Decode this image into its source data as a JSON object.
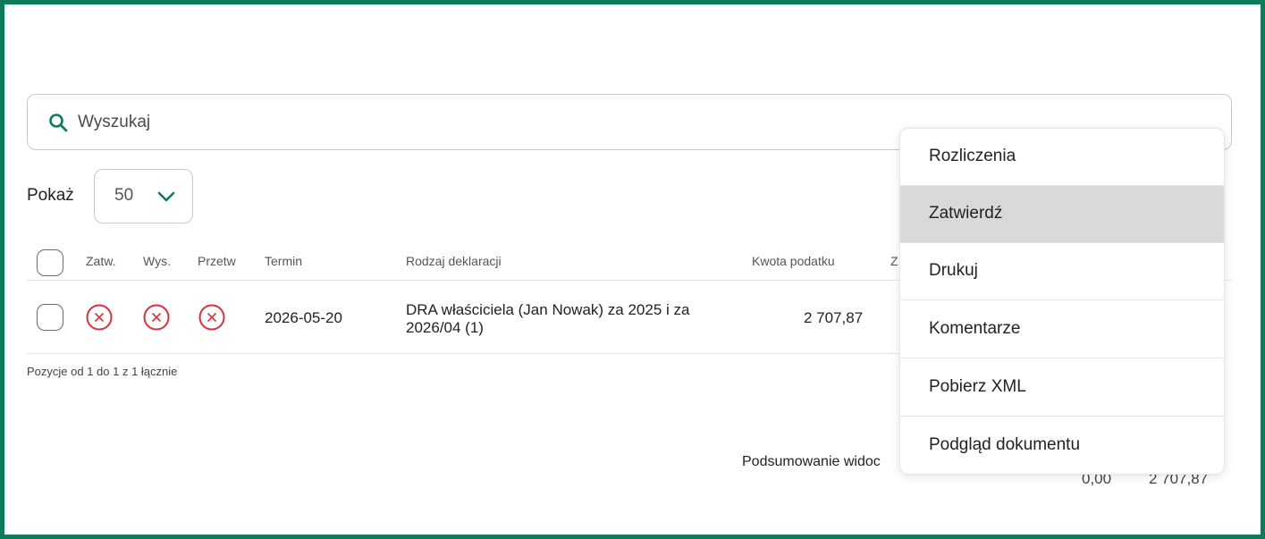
{
  "search": {
    "placeholder": "Wyszukaj"
  },
  "pagination": {
    "show_label": "Pokaż",
    "page_size": "50"
  },
  "table": {
    "headers": {
      "approved": "Zatw.",
      "sent": "Wys.",
      "processed": "Przetw",
      "deadline": "Termin",
      "declaration_type": "Rodzaj deklaracji",
      "tax_amount": "Kwota podatku",
      "partial": "Z"
    },
    "rows": [
      {
        "deadline": "2026-05-20",
        "declaration_type": "DRA właściciela (Jan Nowak) za 2025 i za 2026/04 (1)",
        "tax_amount": "2 707,87"
      }
    ],
    "footer_info": "Pozycje od 1 do 1 z 1 łącznie"
  },
  "summary": {
    "label": "Podsumowanie widoc",
    "values": [
      "0,00",
      "2 707,87"
    ]
  },
  "menu": {
    "items": [
      {
        "label": "Rozliczenia"
      },
      {
        "label": "Zatwierdź"
      },
      {
        "label": "Drukuj"
      },
      {
        "label": "Komentarze"
      },
      {
        "label": "Pobierz XML"
      },
      {
        "label": "Podgląd dokumentu"
      }
    ],
    "active_index": 1
  },
  "colors": {
    "accent": "#0f7a5c",
    "error": "#d8323c",
    "hover": "#d9d9d9"
  },
  "icons": {
    "search": "search-icon",
    "dropdown": "chevron-down-icon",
    "status": "x-circle-icon"
  }
}
